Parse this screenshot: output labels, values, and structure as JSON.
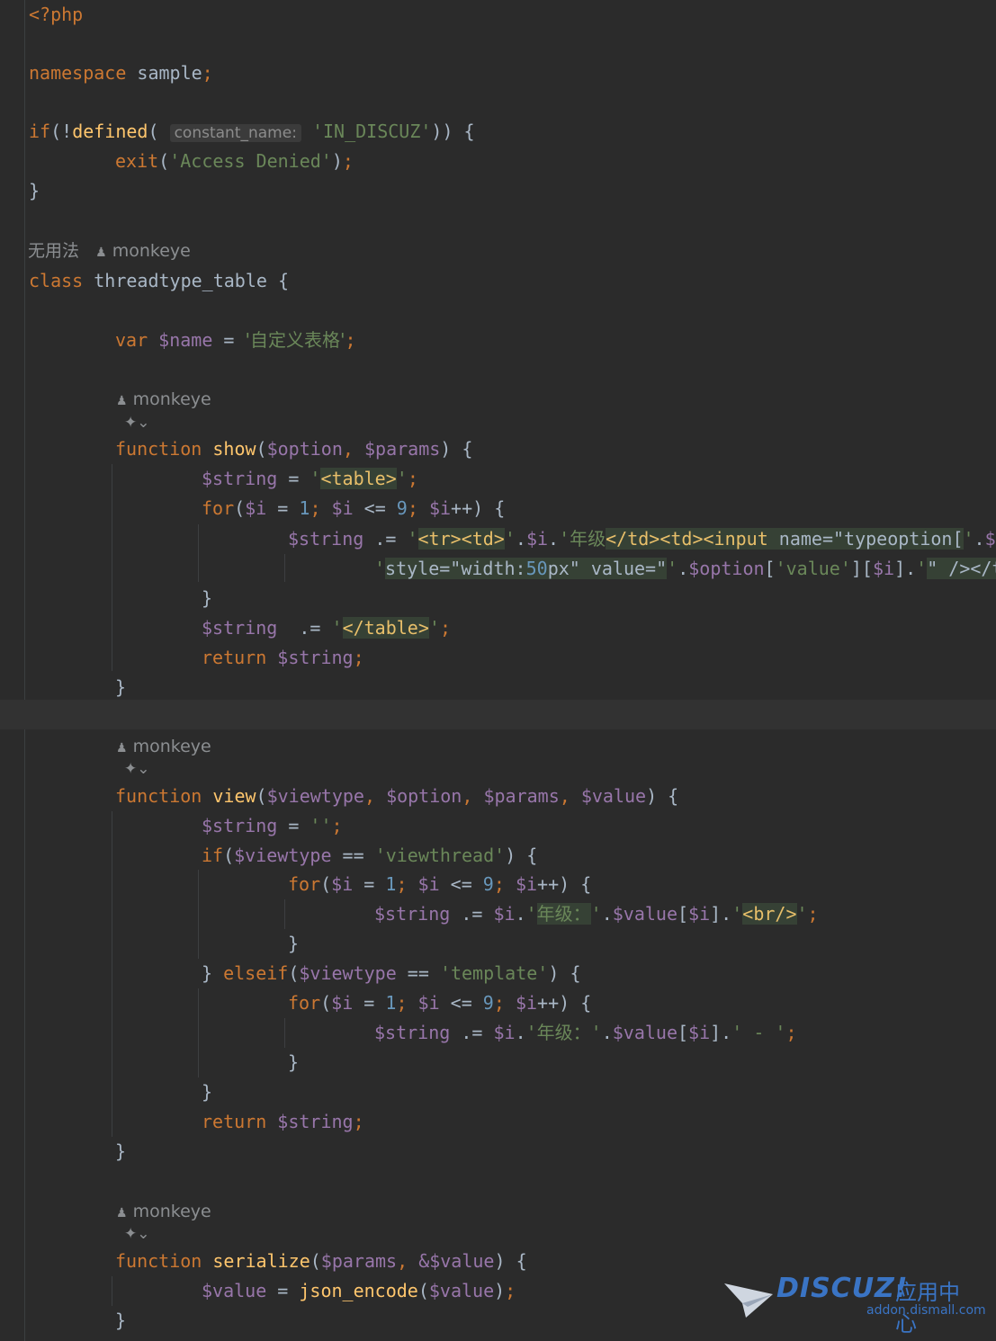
{
  "editor": {
    "php_open": "<?php",
    "namespace_kw": "namespace",
    "namespace_name": "sample",
    "if_kw": "if",
    "defined_fn": "defined",
    "param_hint": "constant_name:",
    "in_discuz": "'IN_DISCUZ'",
    "exit_fn": "exit",
    "access_denied": "'Access Denied'",
    "usage_hint": "无用法",
    "author": "monkeye",
    "author_icon": "person-icon",
    "ai_icon": "ai-assistant-icon",
    "class_kw": "class",
    "class_name": "threadtype_table",
    "var_kw": "var",
    "var_name": "$name",
    "var_value": "'自定义表格'",
    "function_kw": "function",
    "fn_show": "show",
    "fn_view": "view",
    "fn_serialize": "serialize",
    "json_encode": "json_encode",
    "return_kw": "return",
    "for_kw": "for",
    "elseif_kw": "elseif",
    "var_string": "$string",
    "var_option": "$option",
    "var_params": "$params",
    "var_i": "$i",
    "var_viewtype": "$viewtype",
    "var_value_arg": "$value",
    "amp_value": "&$value",
    "lit_table_open": "<table>",
    "lit_table_close": "</table>",
    "lit_tr_td": "<tr><td>",
    "lit_grade": "年级",
    "lit_td_input": "</td><td><input",
    "lit_name_attr": " name=\"typeoption[",
    "lit_tail_cut": "$o",
    "lit_style": "style=\"width:",
    "lit_50": "50",
    "lit_px_value": "px\" value=\"",
    "lit_value_key": "'value'",
    "lit_close_tail": "\" /></t",
    "lit_viewthread": "'viewthread'",
    "lit_template": "'template'",
    "lit_grade_colon": "年级：",
    "lit_br": "<br/>",
    "lit_dash": " - ",
    "num_1": "1",
    "num_9": "9",
    "empty_str": "''"
  },
  "watermark": {
    "logo": "DISCUZ!",
    "suffix": "应用中心",
    "url": "addon.dismall.com"
  }
}
